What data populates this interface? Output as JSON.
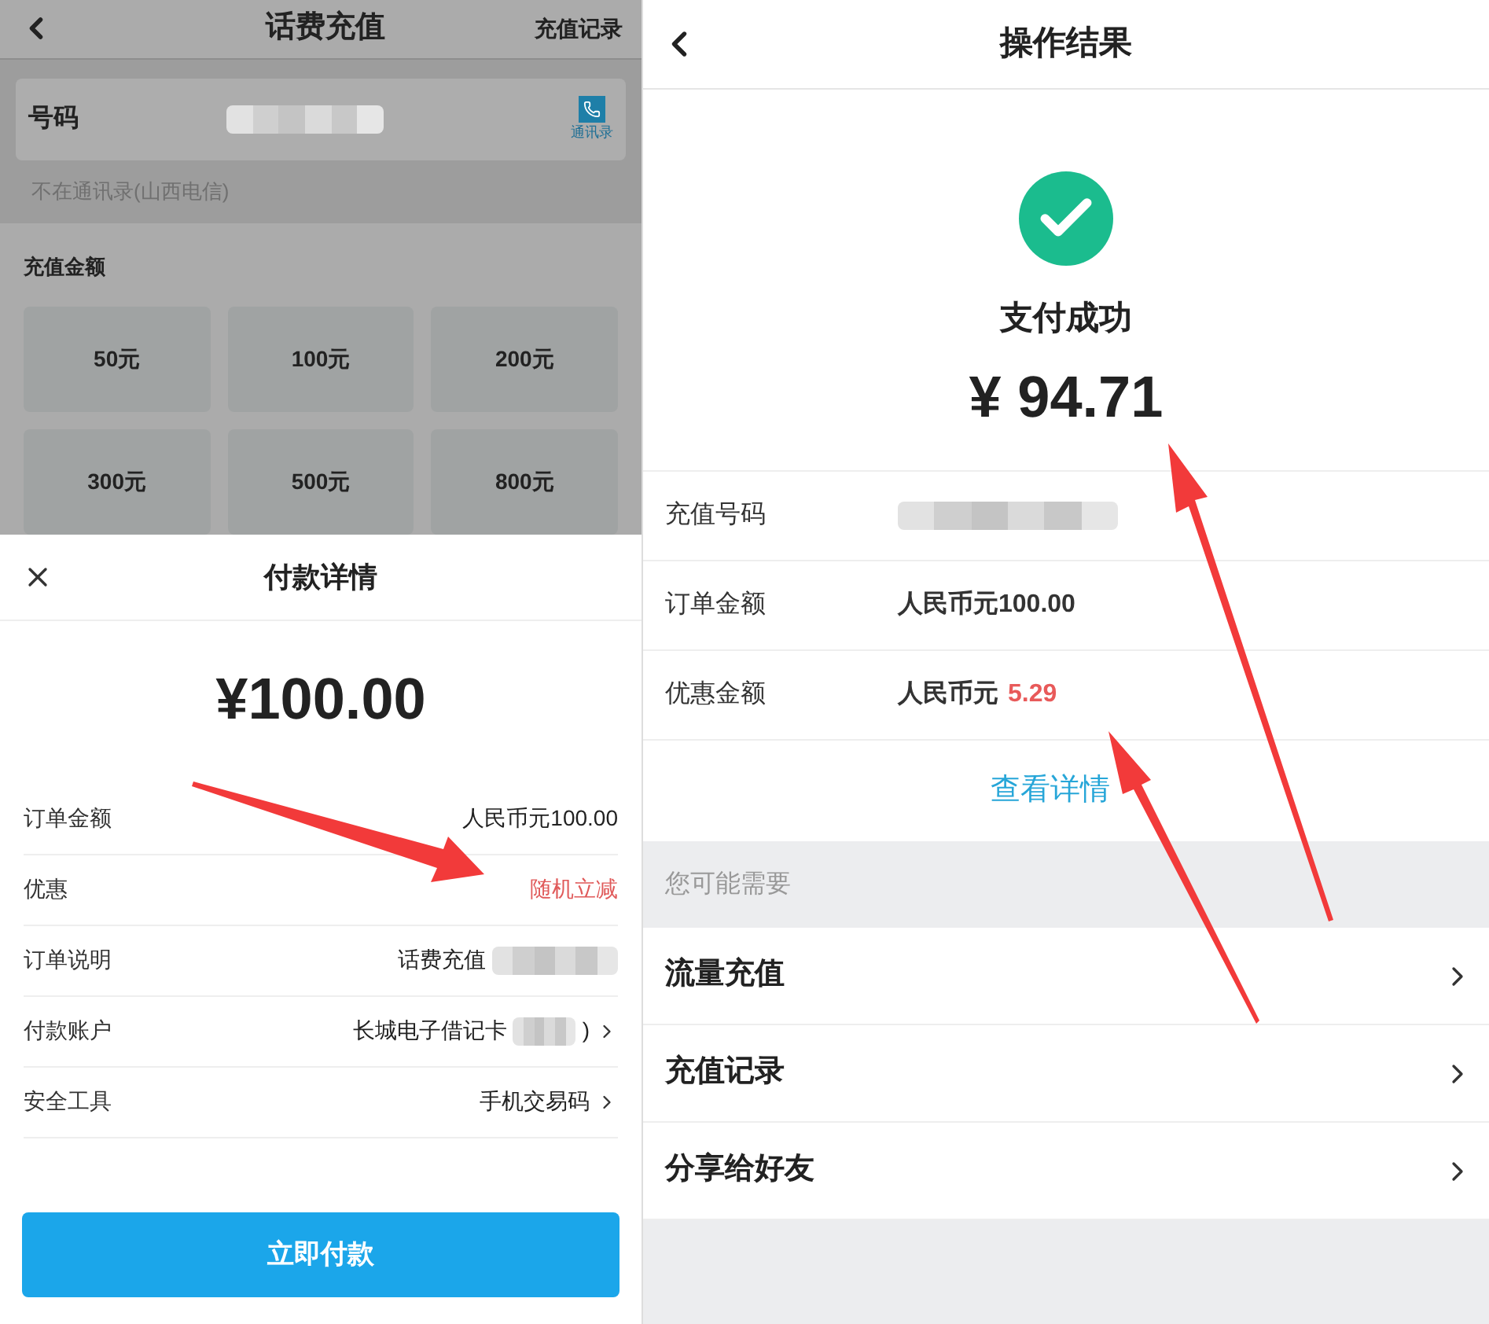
{
  "left_screen": {
    "header": {
      "title": "话费充值",
      "action": "充值记录"
    },
    "phone_field": {
      "label": "号码",
      "contacts_label": "通讯录",
      "redacted": true
    },
    "carrier_note": "不在通讯录(山西电信)",
    "amount_section": {
      "title": "充值金额",
      "options": [
        "50元",
        "100元",
        "200元",
        "300元",
        "500元",
        "800元"
      ]
    },
    "payment_sheet": {
      "title": "付款详情",
      "amount": "¥100.00",
      "rows": [
        {
          "label": "订单金额",
          "value": "人民币元100.00",
          "highlighted": false,
          "redacted": false,
          "chevron": false
        },
        {
          "label": "优惠",
          "value": "随机立减",
          "highlighted": true,
          "redacted": false,
          "chevron": false
        },
        {
          "label": "订单说明",
          "value": "话费充值",
          "highlighted": false,
          "redacted": true,
          "chevron": false
        },
        {
          "label": "付款账户",
          "value": "长城电子借记卡",
          "suffix": ")",
          "highlighted": false,
          "redacted": true,
          "chevron": true
        },
        {
          "label": "安全工具",
          "value": "手机交易码",
          "highlighted": false,
          "redacted": false,
          "chevron": true
        }
      ],
      "pay_button": "立即付款"
    }
  },
  "right_screen": {
    "header": {
      "title": "操作结果"
    },
    "status": "支付成功",
    "amount": "¥ 94.71",
    "rows": [
      {
        "label": "充值号码",
        "redacted": true
      },
      {
        "label": "订单金额",
        "value": "人民币元100.00",
        "redacted": false
      },
      {
        "label": "优惠金额",
        "value": "人民币元",
        "highlight": "5.29",
        "redacted": false
      }
    ],
    "details_link": "查看详情",
    "suggestions": {
      "title": "您可能需要",
      "items": [
        "流量充值",
        "充值记录",
        "分享给好友"
      ]
    }
  }
}
